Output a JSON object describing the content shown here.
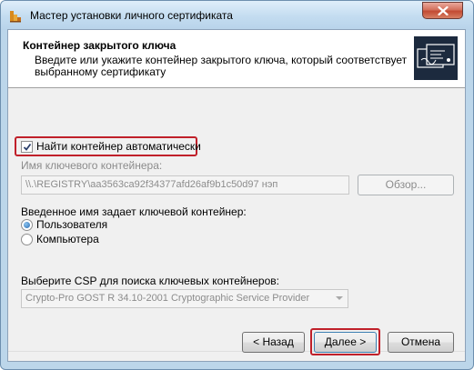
{
  "window": {
    "title": "Мастер установки личного сертификата"
  },
  "header": {
    "title": "Контейнер закрытого ключа",
    "description": "Введите или укажите контейнер закрытого ключа, который соответствует выбранному сертификату"
  },
  "auto_find": {
    "label": "Найти контейнер автоматически",
    "checked": true
  },
  "container": {
    "label": "Имя ключевого контейнера:",
    "value": "\\\\.\\REGISTRY\\aa3563ca92f34377afd26af9b1c50d97 нэп",
    "browse_label": "Обзор..."
  },
  "key_source": {
    "label": "Введенное имя задает ключевой контейнер:",
    "options": [
      {
        "label": "Пользователя",
        "selected": true
      },
      {
        "label": "Компьютера",
        "selected": false
      }
    ]
  },
  "csp": {
    "label": "Выберите CSP для поиска ключевых контейнеров:",
    "selected": "Crypto-Pro GOST R 34.10-2001 Cryptographic Service Provider"
  },
  "buttons": {
    "back": "< Назад",
    "next": "Далее >",
    "cancel": "Отмена"
  },
  "colors": {
    "highlight": "#c0202a",
    "radio_selected": "#2a6bb3"
  }
}
